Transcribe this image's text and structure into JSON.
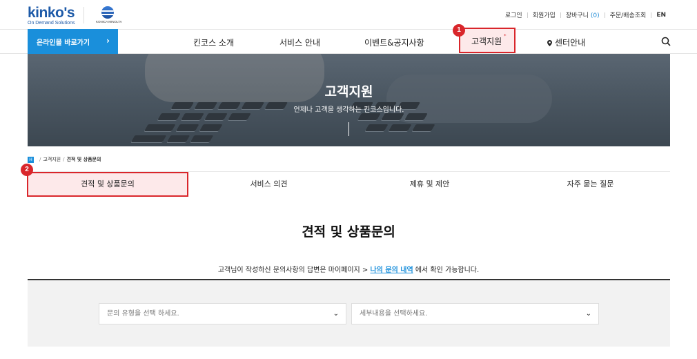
{
  "brand": {
    "logo_text": "kinko's",
    "logo_sub": "On Demand Solutions",
    "partner_text": "KONICA MINOLTA"
  },
  "utility": {
    "login": "로그인",
    "join": "회원가입",
    "cart_label": "장바구니",
    "cart_count": "(0)",
    "orders": "주문/배송조회",
    "lang": "EN"
  },
  "nav": {
    "online_label": "온라인몰 바로가기",
    "items": [
      "킨코스 소개",
      "서비스 안내",
      "이벤트&공지사항",
      "고객지원",
      "센터안내"
    ],
    "active_marker": "*"
  },
  "badges": [
    "1",
    "2"
  ],
  "hero": {
    "title": "고객지원",
    "subtitle": "언제나 고객을 생각하는 킨코스입니다."
  },
  "breadcrumb": {
    "home_icon": "H",
    "items": [
      "고객지원",
      "견적 및 상품문의"
    ]
  },
  "tabs": [
    "견적 및 상품문의",
    "서비스 의견",
    "제휴 및 제안",
    "자주 묻는 질문"
  ],
  "content": {
    "title": "견적 및 상품문의",
    "notice_before": "고객님이 작성하신 문의사항의 답변은 마이페이지 > ",
    "notice_link": "나의 문의 내역",
    "notice_after": " 에서 확인 가능합니다."
  },
  "selects": {
    "type_placeholder": "문의 유형을 선택 하세요.",
    "detail_placeholder": "세부내용을 선택하세요."
  },
  "colors": {
    "brand_blue": "#1d5aa8",
    "online_button": "#1a8fdb",
    "highlight_red": "#d9262b",
    "highlight_fill": "#fde9ea"
  }
}
